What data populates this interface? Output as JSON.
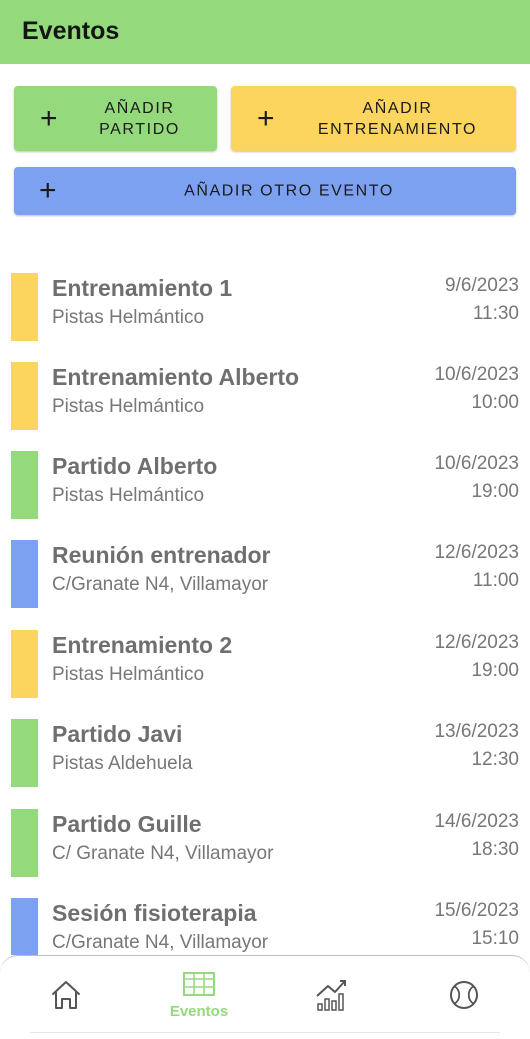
{
  "appbar": {
    "title": "Eventos"
  },
  "actions": {
    "add_match": {
      "plus": "+",
      "label": "AÑADIR\nPARTIDO",
      "color": "#94d97c"
    },
    "add_training": {
      "plus": "+",
      "label": "AÑADIR\nENTRENAMIENTO",
      "color": "#fbd55e"
    },
    "add_other": {
      "plus": "+",
      "label": "AÑADIR OTRO EVENTO",
      "color": "#7da1f1"
    }
  },
  "event_types": {
    "training": "#fbd55e",
    "match": "#94d97c",
    "other": "#7da1f1"
  },
  "events": [
    {
      "title": "Entrenamiento 1",
      "place": "Pistas Helmántico",
      "date": "9/6/2023",
      "time": "11:30",
      "type": "training"
    },
    {
      "title": "Entrenamiento Alberto",
      "place": "Pistas Helmántico",
      "date": "10/6/2023",
      "time": "10:00",
      "type": "training"
    },
    {
      "title": "Partido Alberto",
      "place": "Pistas Helmántico",
      "date": "10/6/2023",
      "time": "19:00",
      "type": "match"
    },
    {
      "title": "Reunión entrenador",
      "place": "C/Granate N4, Villamayor",
      "date": "12/6/2023",
      "time": "11:00",
      "type": "other"
    },
    {
      "title": "Entrenamiento 2",
      "place": "Pistas Helmántico",
      "date": "12/6/2023",
      "time": "19:00",
      "type": "training"
    },
    {
      "title": "Partido Javi",
      "place": "Pistas Aldehuela",
      "date": "13/6/2023",
      "time": "12:30",
      "type": "match"
    },
    {
      "title": "Partido Guille",
      "place": "C/ Granate N4, Villamayor",
      "date": "14/6/2023",
      "time": "18:30",
      "type": "match"
    },
    {
      "title": "Sesión fisioterapia",
      "place": "C/Granate N4, Villamayor",
      "date": "15/6/2023",
      "time": "15:10",
      "type": "other"
    }
  ],
  "bottom_nav": {
    "items": [
      {
        "icon": "home-icon",
        "label": "",
        "active": false
      },
      {
        "icon": "calendar-icon",
        "label": "Eventos",
        "active": true
      },
      {
        "icon": "stats-chart-icon",
        "label": "",
        "active": false
      },
      {
        "icon": "tennis-ball-icon",
        "label": "",
        "active": false
      }
    ],
    "active_color": "#94d97c",
    "inactive_color": "#555555"
  }
}
